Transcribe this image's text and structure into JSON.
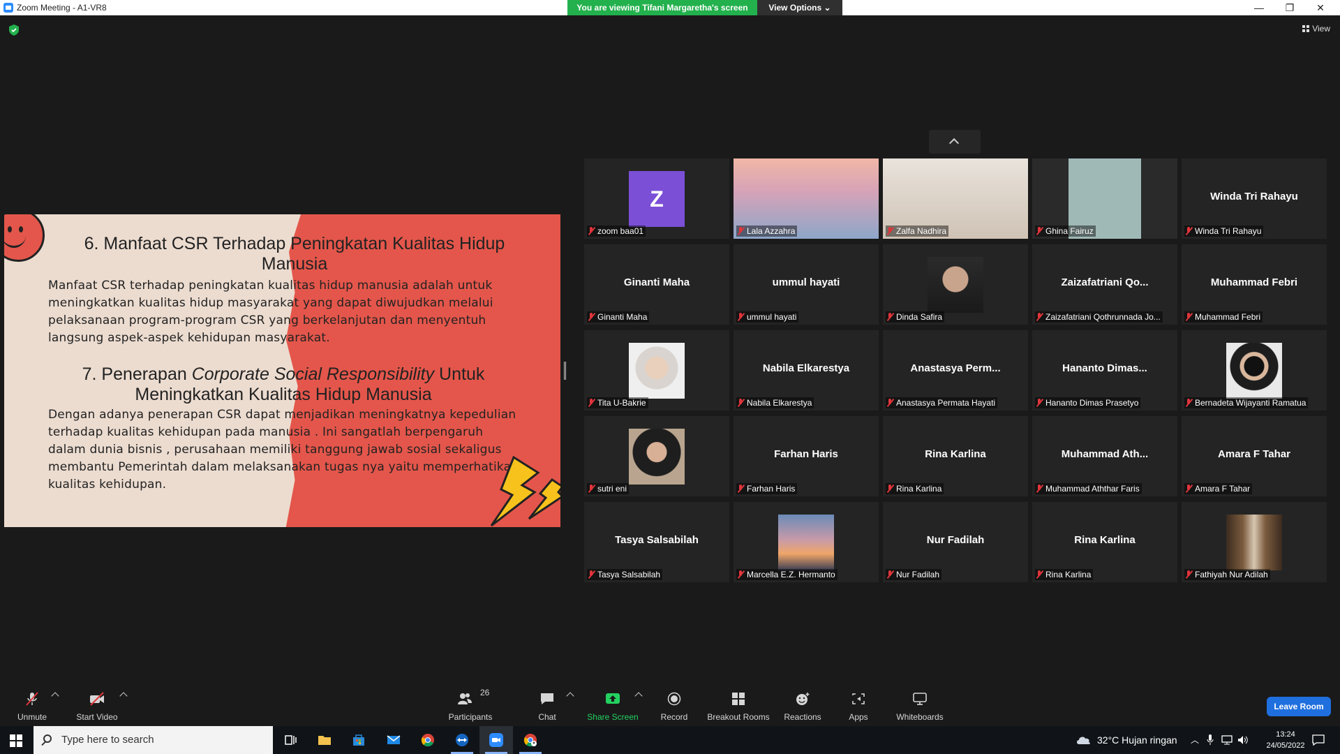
{
  "window": {
    "title": "Zoom Meeting - A1-VR8",
    "banner": "You are viewing Tifani Margaretha's screen",
    "view_options": "View Options",
    "view_button": "View"
  },
  "slide": {
    "heading6": "6. Manfaat CSR Terhadap Peningkatan Kualitas Hidup Manusia",
    "para6": "Manfaat CSR terhadap peningkatan kualitas hidup manusia adalah untuk meningkatkan kualitas hidup masyarakat yang dapat diwujudkan melalui pelaksanaan program-program CSR yang berkelanjutan dan menyentuh langsung aspek-aspek kehidupan masyarakat.",
    "heading7_prefix": "7. Penerapan ",
    "heading7_italic": "Corporate Social Responsibility",
    "heading7_suffix": " Untuk Meningkatkan Kualitas Hidup Manusia",
    "para7": "Dengan adanya penerapan CSR dapat menjadikan meningkatnya kepedulian terhadap kualitas kehidupan pada manusia . Ini sangatlah berpengaruh dalam dunia bisnis , perusahaan memiliki tanggung jawab sosial sekaligus membantu Pemerintah dalam melaksanakan tugas nya yaitu memperhatikan kualitas kehidupan."
  },
  "participants": [
    {
      "label": "zoom baa01",
      "big": "",
      "avatar": "Z"
    },
    {
      "label": "Lala Azzahra",
      "big": "",
      "video": "sky"
    },
    {
      "label": "Zalfa Nadhira",
      "big": "",
      "video": "room"
    },
    {
      "label": "Ghina Fairuz",
      "big": "",
      "video": "window"
    },
    {
      "label": "Winda Tri Rahayu",
      "big": "Winda Tri Rahayu"
    },
    {
      "label": "Ginanti Maha",
      "big": "Ginanti Maha"
    },
    {
      "label": "ummul hayati",
      "big": "ummul hayati"
    },
    {
      "label": "Dinda Safira",
      "big": "",
      "photo": "portrait-dark"
    },
    {
      "label": "Zaizafatriani Qothrunnada Jo...",
      "big": "Zaizafatriani  Qo..."
    },
    {
      "label": "Muhammad Febri",
      "big": "Muhammad Febri"
    },
    {
      "label": "Tita U-Bakrie",
      "big": "",
      "photo": "hijab-light"
    },
    {
      "label": "Nabila Elkarestya",
      "big": "Nabila Elkarestya"
    },
    {
      "label": "Anastasya Permata Hayati",
      "big": "Anastasya  Perm..."
    },
    {
      "label": "Hananto Dimas Prasetyo",
      "big": "Hananto  Dimas..."
    },
    {
      "label": "Bernadeta Wijayanti Ramatua",
      "big": "",
      "photo": "mask"
    },
    {
      "label": "sutri eni",
      "big": "",
      "photo": "hijab-dark"
    },
    {
      "label": "Farhan Haris",
      "big": "Farhan Haris"
    },
    {
      "label": "Rina Karlina",
      "big": "Rina Karlina"
    },
    {
      "label": "Muhammad Aththar Faris",
      "big": "Muhammad  Ath..."
    },
    {
      "label": "Amara F Tahar",
      "big": "Amara F Tahar"
    },
    {
      "label": "Tasya Salsabilah",
      "big": "Tasya Salsabilah"
    },
    {
      "label": "Marcella E.Z. Hermanto",
      "big": "",
      "photo": "sunset"
    },
    {
      "label": "Nur Fadilah",
      "big": "Nur Fadilah"
    },
    {
      "label": "Rina Karlina",
      "big": "Rina Karlina"
    },
    {
      "label": "Fathiyah Nur Adilah",
      "big": "",
      "photo": "shelf"
    }
  ],
  "toolbar": {
    "unmute": "Unmute",
    "start_video": "Start Video",
    "participants": "Participants",
    "participants_count": "26",
    "chat": "Chat",
    "share_screen": "Share Screen",
    "record": "Record",
    "breakout_rooms": "Breakout Rooms",
    "reactions": "Reactions",
    "apps": "Apps",
    "whiteboards": "Whiteboards",
    "leave": "Leave Room"
  },
  "taskbar": {
    "search_placeholder": "Type here to search",
    "weather": "32°C  Hujan ringan",
    "time": "13:24",
    "date": "24/05/2022"
  },
  "colors": {
    "banner_green": "#23b14d",
    "slide_red": "#e4564b",
    "leave_blue": "#1f6fde",
    "muted_red": "#e0353b"
  }
}
